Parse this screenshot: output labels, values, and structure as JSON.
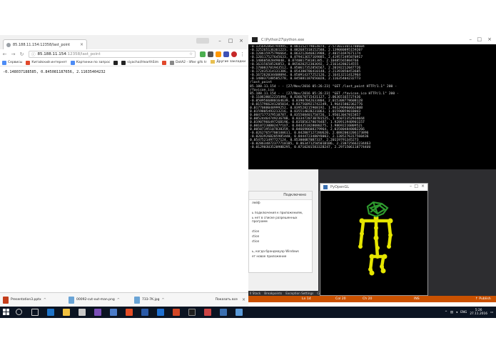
{
  "browser": {
    "tab_title": "85.188.11.154:12358/last_point",
    "omnibox_host": "85.188.11.154",
    "omnibox_path": ":12358/last_point",
    "bookmarks": [
      {
        "label": "Сервисы",
        "color": "#4c8bf5"
      },
      {
        "label": "Китайский интернет",
        "color": "#e0482b"
      },
      {
        "label": "Картинки по запрос",
        "color": "#4c8bf5"
      },
      {
        "label": "",
        "color": "#222222"
      },
      {
        "label": "siyachai/HearthSim",
        "color": "#222222"
      },
      {
        "label": "",
        "color": "#e0482b"
      },
      {
        "label": "DotA2 - lifter gifs tr",
        "color": "#888888"
      }
    ],
    "other_bookmarks": "Другие закладки",
    "page_text": "-0.148037188585, 0.845081187656, 2.11635404232",
    "downloads": [
      {
        "name": "Presentation3.pptx",
        "kind": "pptx"
      },
      {
        "name": "00092-cut-out-man.png",
        "kind": "img"
      },
      {
        "name": "733-7K.jpg",
        "kind": "img"
      }
    ],
    "show_all": "Показать все"
  },
  "console": {
    "title": "C:\\Python27\\python.exe",
    "lines": [
      "-0.135692864794995, 0.881152779014874, 2.57302236517006B4",
      "-0.125265136361223, 0.882687318152588, 2.13908089515920?",
      "-0.120615975796664, 0.863212046823988, 2.40151697671174",
      "-0.120117527645633, 0.879413657169885, 2.419572495870917",
      "-0.14060582849848, 0.874001758181385, 2.10485565804766",
      "-0.16315658526853, 0.865020252303692, 2.21614280214555",
      "-0.170083701943512, 0.850617352856567, 2.20192212047726",
      "-0.172435314131386, 0.854380786410148, 2.21393850453605",
      "-0.167262034408094, 0.850914377252126, 2.16413211412964",
      "-0.148037188585278, 0.845081187656028, 2.11635404232773",
      "/last_point",
      "85.188.11.154 - - [27/Nov/2016 05:26:23] \"GET /last_point HTTP/1.1\" 200 -",
      "/favicon.ico",
      "85.188.11.154 - - [27/Nov/2016 05:26:23] \"GET /favicon.ico HTTP/1.1\" 200 -",
      "-0.110638012235494, 0.836670715431127, 2.06365165727436",
      "-0.0509566880164639, 0.83907842633804, 2.01530877860B128",
      "-0.0157966241205014, 0.837568921742249, 1.96415802362776",
      "0.0177088048999252, 0.839528215908192, 1.94129696066280B",
      "0.0159805493213216, 0.835514B2B231B63, 1.01590B5901B0U3",
      "0.0047177379510787, 0.835508401758726, 1.95013047815857",
      "0.00524464749236788, 0.833472073B7B1525, 1.95072352934044",
      "0.0190796649726B196, 0.835B563780784B7, 1.92891194B901157",
      "0.00107230B0247Y1U7, 0.844351828080275, 1.98692216B0952i",
      "0.00507195107838359, 0.846698608379964, 2.0358048480B2266",
      "-0.0262765Y7001U0611, 0.842B0712728U620, 2.0882003206173896",
      "-0.0203926B205985440, 0.8444723480Y8003, 2.1385276317560436",
      "0.0547521497727124, 0.853000B70B7337, 2.20119791345273",
      "-0.0286348723777181B5, 0.863471250501B1B6, 2.238725662234463",
      "-0.012903U352098B295, 0.871020158332B247, 2.29715061187744UU"
    ]
  },
  "vs_dialog": {
    "heading": "Подключено",
    "rows": [
      "лейф",
      "",
      "ь подключения к приложениям,",
      "ь нет в списке разрешенных программ",
      "",
      "ction",
      "ction",
      "ction",
      "",
      "ь, когда брандмауэр Windows",
      "ет новое приложение"
    ]
  },
  "vs_tabs": [
    "ll Stack",
    "Breakpoints",
    "Exception Settings",
    "Comma"
  ],
  "vs_status": {
    "ln": "Ln 14",
    "col": "Col 20",
    "ch": "Ch 20",
    "ins": "INS",
    "publish": "↑ Publish"
  },
  "gl_window": {
    "title": "PyOpenGL"
  },
  "taskbar": {
    "lang": "ENG",
    "time": "5:26",
    "date": "27.11.2016"
  },
  "colors": {
    "accent": "#ca5100",
    "skeleton": "#e6e600",
    "head": "#2e9b2e"
  }
}
